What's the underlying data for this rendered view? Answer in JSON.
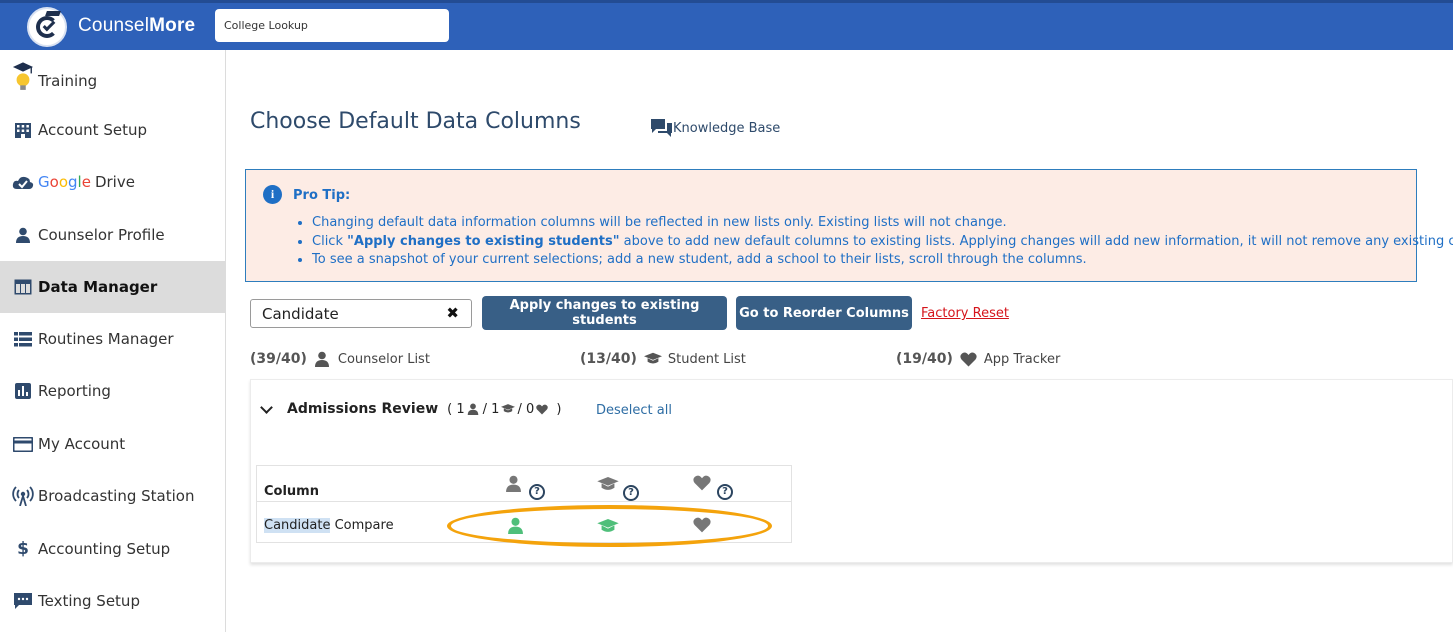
{
  "app": {
    "brand_regular": "Counsel",
    "brand_bold": "More",
    "college_lookup_placeholder": "College Lookup"
  },
  "sidebar": {
    "items": [
      {
        "label": "Training",
        "icon": "lightbulb-graduation-icon"
      },
      {
        "label": "Account Setup",
        "icon": "building-icon"
      },
      {
        "label": "Drive",
        "prefix": "Google",
        "icon": "cloud-check-icon"
      },
      {
        "label": "Counselor Profile",
        "icon": "person-icon"
      },
      {
        "label": "Data Manager",
        "icon": "table-icon",
        "active": true
      },
      {
        "label": "Routines Manager",
        "icon": "list-icon"
      },
      {
        "label": "Reporting",
        "icon": "bar-chart-icon"
      },
      {
        "label": "My Account",
        "icon": "credit-card-icon"
      },
      {
        "label": "Broadcasting Station",
        "icon": "broadcast-icon"
      },
      {
        "label": "Accounting Setup",
        "icon": "dollar-icon"
      },
      {
        "label": "Texting Setup",
        "icon": "chat-icon"
      }
    ]
  },
  "main": {
    "title": "Choose Default Data Columns",
    "knowledge_base": "Knowledge Base",
    "pro_tip": {
      "title": "Pro Tip:",
      "bullets": [
        {
          "text": "Changing default data information columns will be reflected in new lists only. Existing lists will not change."
        },
        {
          "pre": "Click ",
          "bold": "\"Apply changes to existing students\"",
          "post": " above to add new default columns to existing lists. Applying changes will add new information, it will not remove any existing columns."
        },
        {
          "text": "To see a snapshot of your current selections; add a new student, add a school to their lists, scroll through the columns."
        }
      ]
    },
    "search_value": "Candidate",
    "apply_button": "Apply changes to existing students",
    "reorder_button": "Go to Reorder Columns",
    "factory_reset": "Factory Reset",
    "counts": [
      {
        "value": "(39/40)",
        "label": "Counselor List",
        "icon": "person-icon"
      },
      {
        "value": "(13/40)",
        "label": "Student List",
        "icon": "graduation-cap-icon"
      },
      {
        "value": "(19/40)",
        "label": "App Tracker",
        "icon": "heart-icon"
      }
    ],
    "section": {
      "title": "Admissions Review",
      "open": "(",
      "c1": "1",
      "sep1": "/",
      "c2": "1",
      "sep2": "/",
      "c3": "0",
      "close": ")",
      "deselect": "Deselect all"
    },
    "table": {
      "column_header": "Column",
      "header_qmark": "?",
      "row": {
        "highlight": "Candidate",
        "rest": " Compare"
      }
    },
    "colors": {
      "header": "#2e61b9",
      "button": "#385f86",
      "active_green": "#4fbf7a",
      "highlight_ellipse": "#f4a30c",
      "reset_red": "#d5141b"
    }
  }
}
